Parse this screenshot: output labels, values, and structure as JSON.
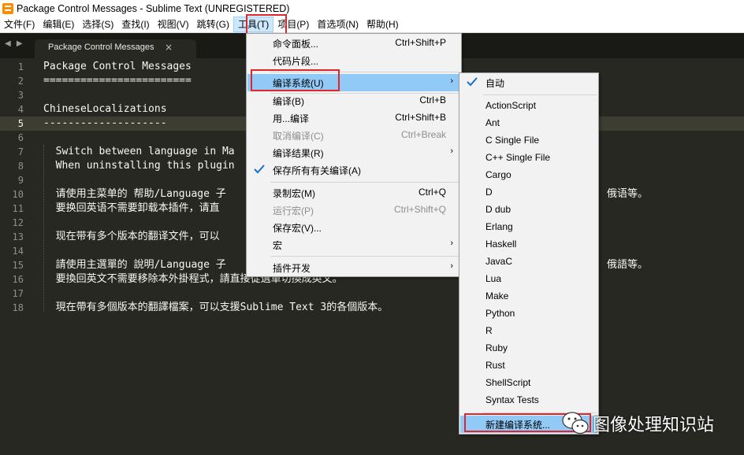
{
  "window": {
    "title": "Package Control Messages - Sublime Text (UNREGISTERED)"
  },
  "menubar": {
    "items": [
      "文件(F)",
      "编辑(E)",
      "选择(S)",
      "查找(I)",
      "视图(V)",
      "跳转(G)",
      "工具(T)",
      "项目(P)",
      "首选项(N)",
      "帮助(H)"
    ]
  },
  "tabs": {
    "arrows": "◀ ▶",
    "active_label": "Package Control Messages",
    "close": "×"
  },
  "editor": {
    "line_numbers": [
      "1",
      "2",
      "3",
      "4",
      "5",
      "6",
      "7",
      "8",
      "9",
      "10",
      "11",
      "12",
      "13",
      "14",
      "15",
      "16",
      "17",
      "18"
    ],
    "lines": [
      "Package Control Messages",
      "========================",
      "",
      "ChineseLocalizations",
      "--------------------",
      "",
      "  Switch between language in Ma",
      "  When uninstalling this plugin",
      "",
      "  请使用主菜单的 帮助/Language 子",
      "  要换回英语不需要卸载本插件，请直",
      "",
      "  现在带有多个版本的翻译文件，可以",
      "",
      "  請使用主選單的 說明/Language 子",
      "  要換回英文不需要移除本外掛程式，請直接從選單切換成英文。",
      "",
      "  現在帶有多個版本的翻譯檔案，可以支援Sublime Text 3的各個版本。"
    ],
    "overflow_right": [
      "俄语等。",
      "俄語等。"
    ]
  },
  "tools_menu": {
    "items": [
      {
        "label": "命令面板...",
        "shortcut": "Ctrl+Shift+P"
      },
      {
        "label": "代码片段...",
        "shortcut": ""
      },
      {
        "label": "编译系统(U)",
        "shortcut": ""
      },
      {
        "label": "编译(B)",
        "shortcut": "Ctrl+B"
      },
      {
        "label": "用...编译",
        "shortcut": "Ctrl+Shift+B"
      },
      {
        "label": "取消编译(C)",
        "shortcut": "Ctrl+Break"
      },
      {
        "label": "编译结果(R)",
        "shortcut": ""
      },
      {
        "label": "保存所有有关编译(A)",
        "shortcut": ""
      },
      {
        "label": "录制宏(M)",
        "shortcut": "Ctrl+Q"
      },
      {
        "label": "运行宏(P)",
        "shortcut": "Ctrl+Shift+Q"
      },
      {
        "label": "保存宏(V)...",
        "shortcut": ""
      },
      {
        "label": "宏",
        "shortcut": ""
      },
      {
        "label": "插件开发",
        "shortcut": ""
      }
    ],
    "submenu_arrow": "›"
  },
  "build_menu": {
    "auto_label": "自动",
    "systems": [
      "ActionScript",
      "Ant",
      "C Single File",
      "C++ Single File",
      "Cargo",
      "D",
      "D dub",
      "Erlang",
      "Haskell",
      "JavaC",
      "Lua",
      "Make",
      "Python",
      "R",
      "Ruby",
      "Rust",
      "ShellScript",
      "Syntax Tests"
    ],
    "new_label": "新建编译系统..."
  },
  "watermark": {
    "text": "图像处理知识站"
  },
  "colors": {
    "editor_bg": "#272822",
    "highlight_red": "#e0262a",
    "menu_hover": "#91c9f7",
    "check_blue": "#1a6fd0"
  }
}
